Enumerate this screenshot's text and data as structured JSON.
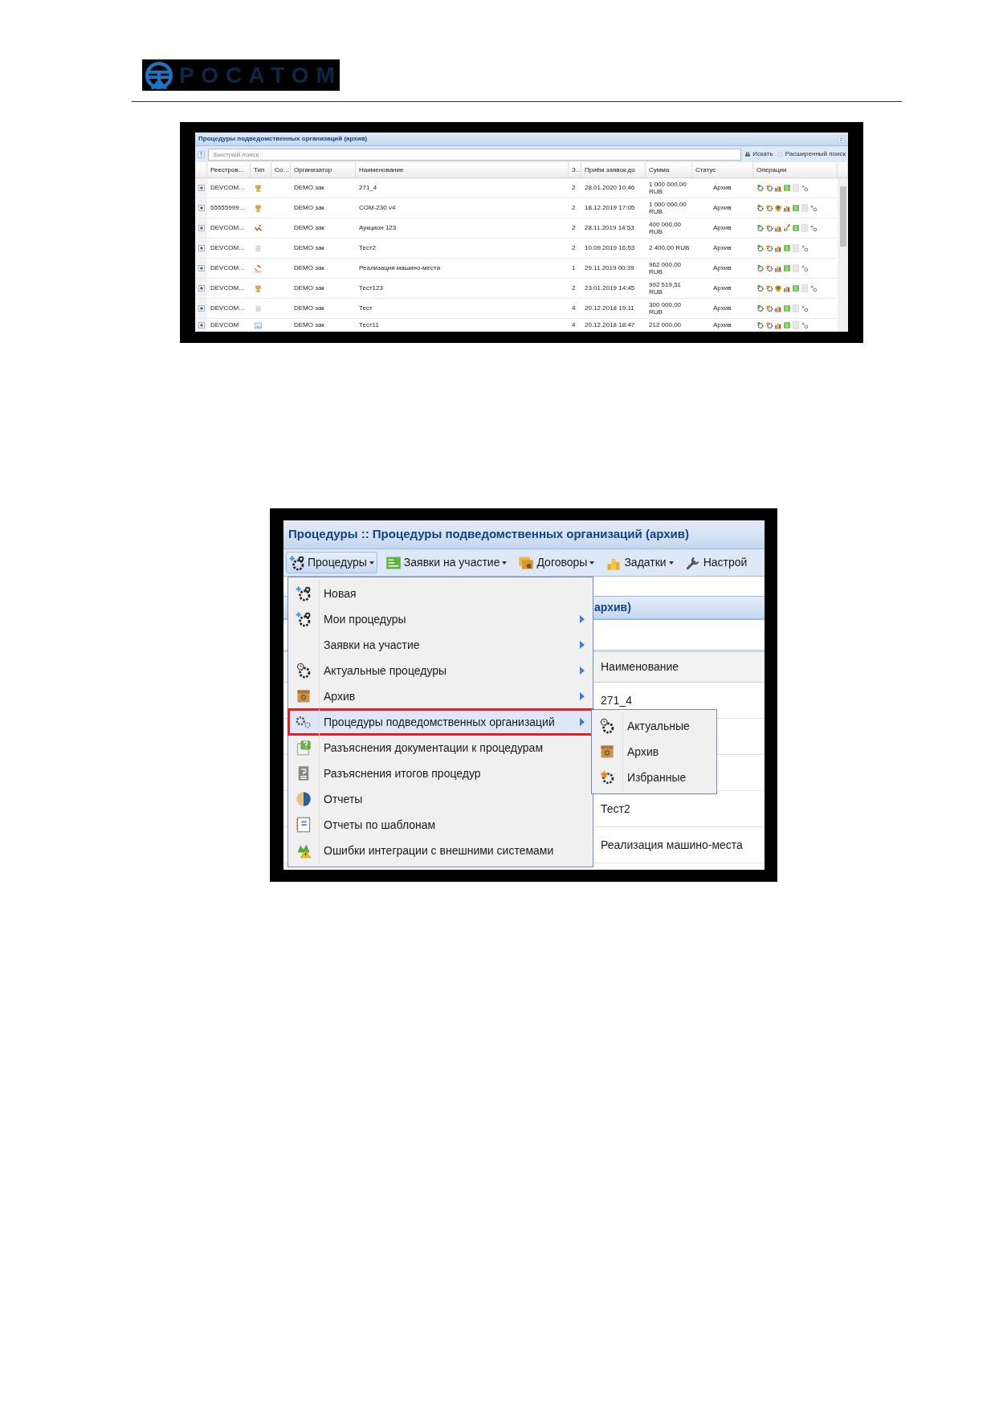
{
  "logo": {
    "text": "РОСАТОМ"
  },
  "archive_grid": {
    "title": "Процедуры подведомственных организаций (архив)",
    "search": {
      "placeholder": "Быстрый поиск"
    },
    "search_button": "Искать",
    "advanced_search": "Расширенный поиск",
    "columns": [
      "Реестров…",
      "Тип",
      "Со…",
      "Организатор",
      "Наименование",
      "З…",
      "Приём заявок до",
      "Сумма",
      "Статус",
      "Операции"
    ],
    "rows": [
      {
        "registry": "DEVCOM…",
        "organizer": "DEMO зак",
        "name": "271_4",
        "bids": "2",
        "deadline": "28.01.2020 10:46",
        "amount": "1 000 000,00 RUB",
        "status": "Архив"
      },
      {
        "registry": "55555999…",
        "organizer": "DEMO зак",
        "name": "COM-230 v4",
        "bids": "2",
        "deadline": "18.12.2019 17:05",
        "amount": "1 000 000,00 RUB",
        "status": "Архив"
      },
      {
        "registry": "DEVCOM…",
        "organizer": "DEMO зак",
        "name": "Аукцион 123",
        "bids": "2",
        "deadline": "28.11.2019 14:53",
        "amount": "400 000,00 RUB",
        "status": "Архив"
      },
      {
        "registry": "DEVCOM…",
        "organizer": "DEMO зак",
        "name": "Тест2",
        "bids": "2",
        "deadline": "10.09.2019 16:53",
        "amount": "2 400,00 RUB",
        "status": "Архив"
      },
      {
        "registry": "DEVCOM…",
        "organizer": "DEMO зак",
        "name": "Реализация машино-места",
        "bids": "1",
        "deadline": "29.11.2019 00:39",
        "amount": "962 000,00 RUB",
        "status": "Архив"
      },
      {
        "registry": "DEVCOM…",
        "organizer": "DEMO зак",
        "name": "Тест123",
        "bids": "2",
        "deadline": "23.01.2019 14:45",
        "amount": "992 519,51 RUB",
        "status": "Архив"
      },
      {
        "registry": "DEVCOM…",
        "organizer": "DEMO зак",
        "name": "Тест",
        "bids": "4",
        "deadline": "20.12.2018 19:11",
        "amount": "300 000,00 RUB",
        "status": "Архив"
      },
      {
        "registry": "DEVCOM",
        "organizer": "DEMO зак",
        "name": "Тест11",
        "bids": "4",
        "deadline": "20.12.2018 18:47",
        "amount": "212 000,00",
        "status": "Архив"
      }
    ]
  },
  "procedures_screen": {
    "title": "Процедуры :: Процедуры подведомственных организаций (архив)",
    "toolbar": [
      {
        "label": "Процедуры",
        "selected": true,
        "dropdown": true
      },
      {
        "label": "Заявки на участие",
        "selected": false,
        "dropdown": true
      },
      {
        "label": "Договоры",
        "selected": false,
        "dropdown": true
      },
      {
        "label": "Задатки",
        "selected": false,
        "dropdown": true
      },
      {
        "label": "Настрой",
        "selected": false,
        "dropdown": false
      }
    ],
    "background_panel": {
      "title": "архив)",
      "column": "Наименование",
      "rows": [
        "271_4",
        "Тест2",
        "Реализация машино-места"
      ]
    },
    "menu": [
      {
        "label": "Новая",
        "submenu": false,
        "selected": false,
        "annotated": false
      },
      {
        "label": "Мои процедуры",
        "submenu": true,
        "selected": false,
        "annotated": false
      },
      {
        "label": "Заявки на участие",
        "submenu": true,
        "selected": false,
        "annotated": false
      },
      {
        "label": "Актуальные процедуры",
        "submenu": true,
        "selected": false,
        "annotated": false
      },
      {
        "label": "Архив",
        "submenu": true,
        "selected": false,
        "annotated": false
      },
      {
        "label": "Процедуры подведомственных организаций",
        "submenu": true,
        "selected": true,
        "annotated": true
      },
      {
        "label": "Разъяснения документации к процедурам",
        "submenu": false,
        "selected": false,
        "annotated": false
      },
      {
        "label": "Разъяснения итогов процедур",
        "submenu": false,
        "selected": false,
        "annotated": false
      },
      {
        "label": "Отчеты",
        "submenu": false,
        "selected": false,
        "annotated": false
      },
      {
        "label": "Отчеты по шаблонам",
        "submenu": false,
        "selected": false,
        "annotated": false
      },
      {
        "label": "Ошибки интеграции с внешними системами",
        "submenu": false,
        "selected": false,
        "annotated": false
      }
    ],
    "submenu": [
      "Актуальные",
      "Архив",
      "Избранные"
    ]
  }
}
